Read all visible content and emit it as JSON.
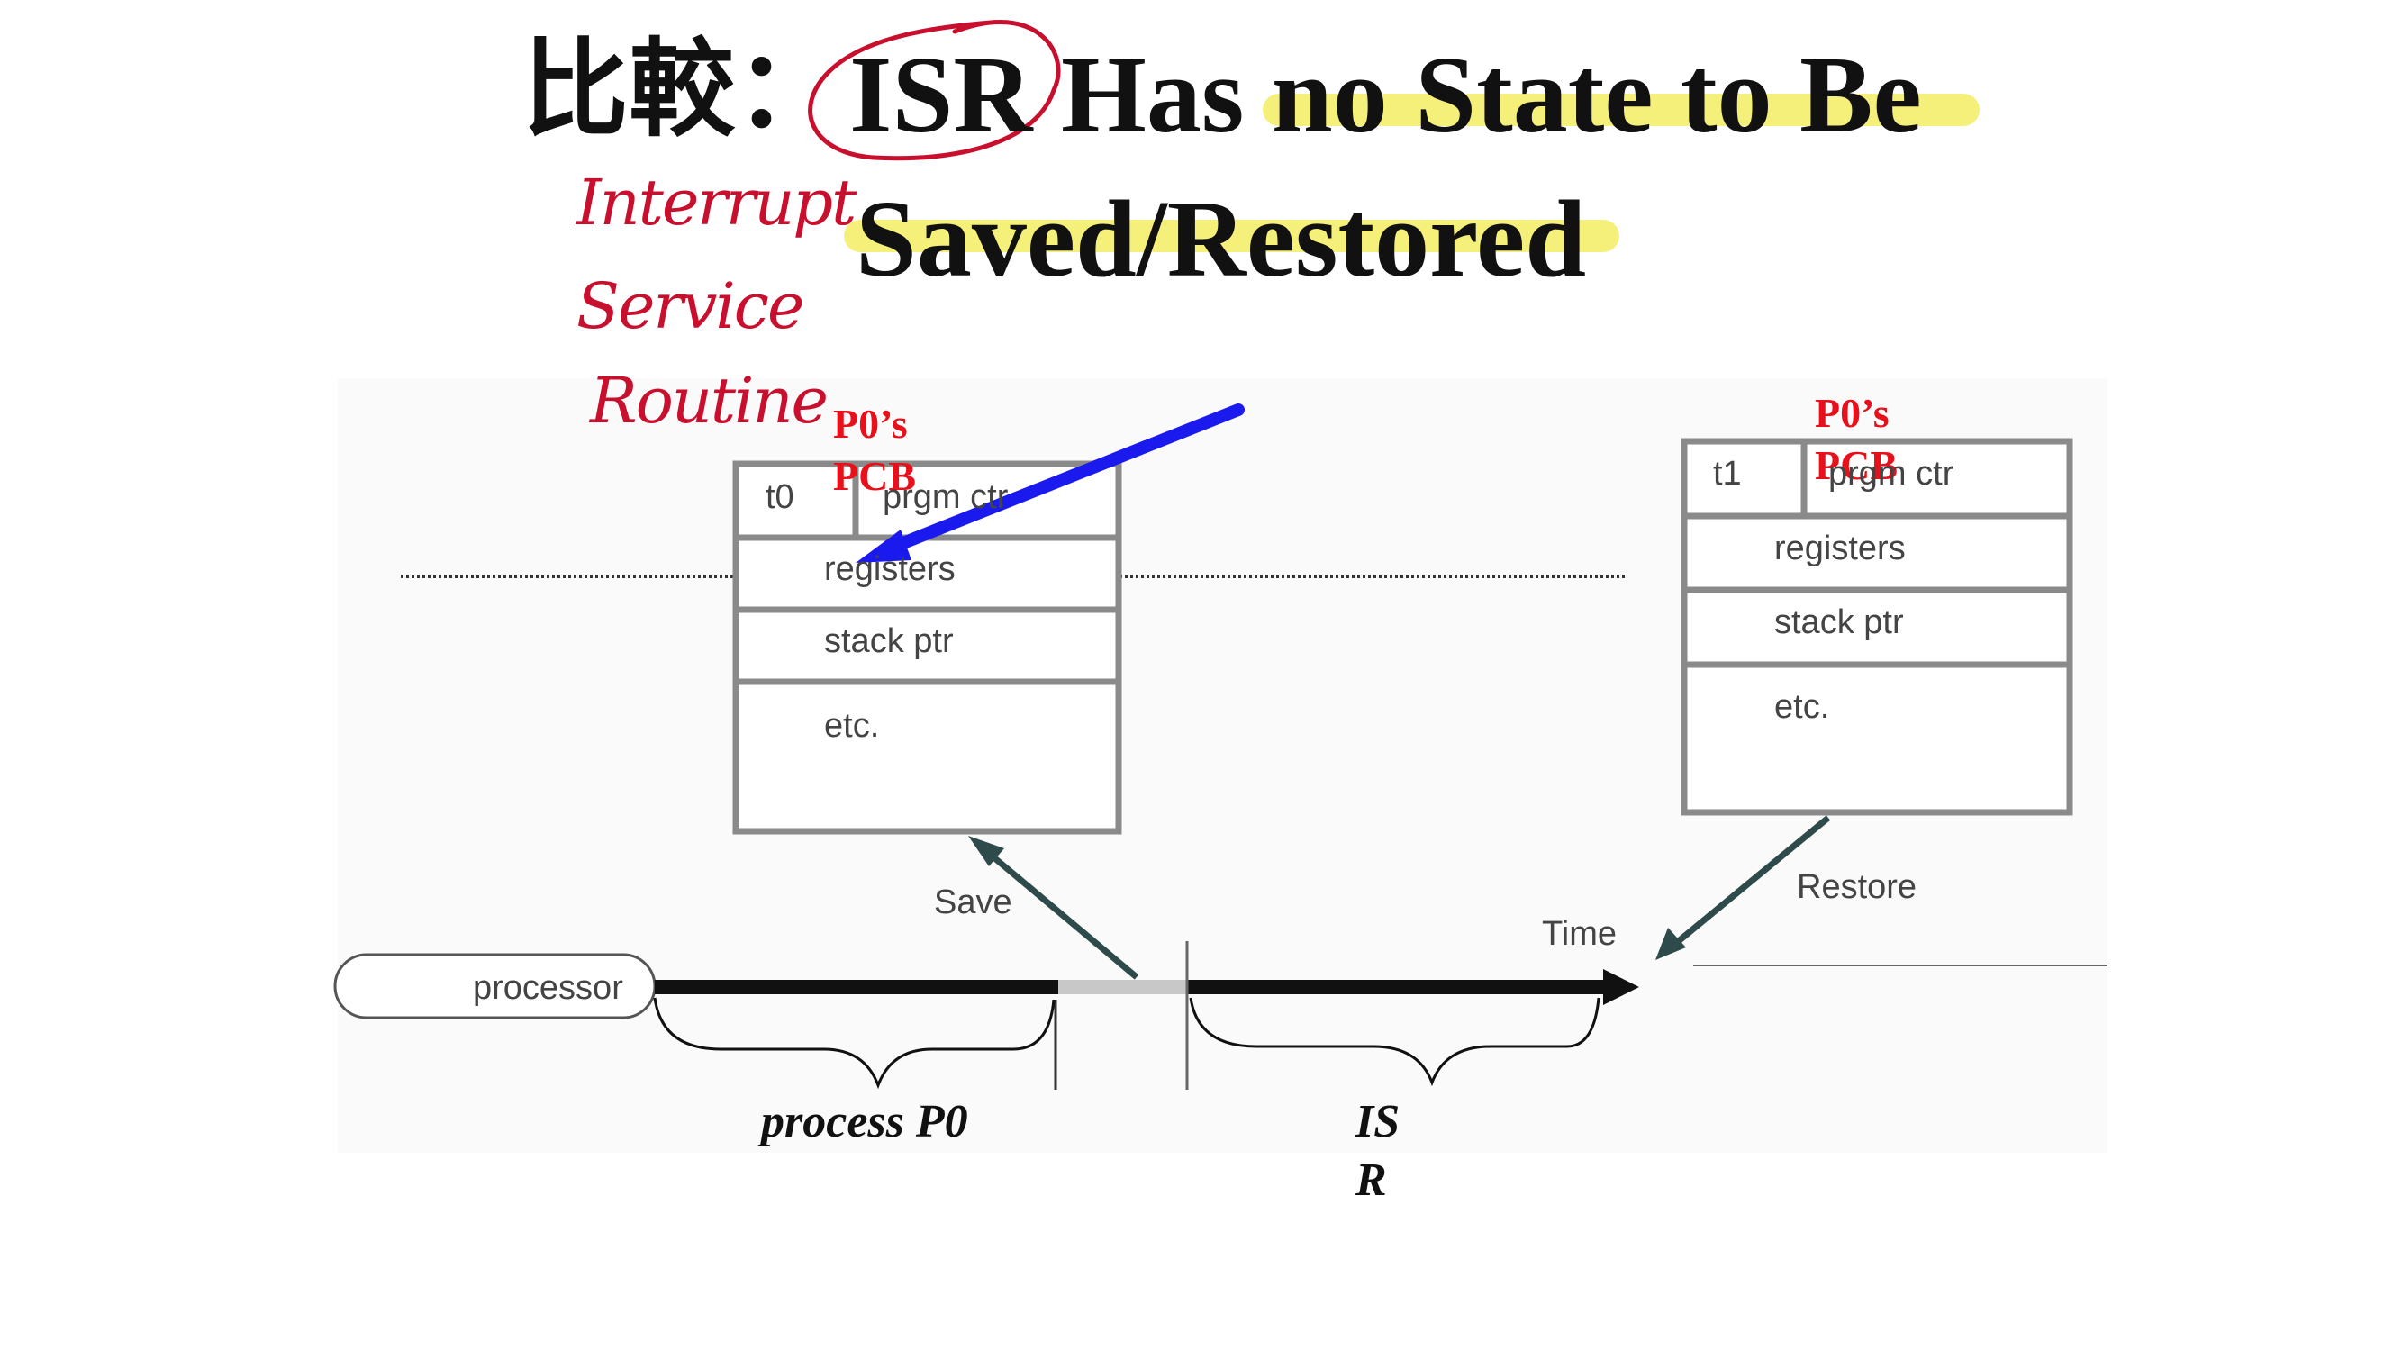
{
  "title": {
    "prefix": "比較：",
    "isr": "ISR",
    "line1_rest": "Has no State to Be",
    "line2": "Saved/Restored"
  },
  "annotation": {
    "line1": "Interrupt",
    "line2": "Service",
    "line3": "Routine"
  },
  "pcb_left": {
    "label_line1": "P0’s",
    "label_line2": "PCB",
    "time": "t0",
    "pc": "prgm ctr",
    "registers": "registers",
    "stack": "stack ptr",
    "etc": "etc."
  },
  "pcb_right": {
    "label_line1": "P0’s",
    "label_line2": "PCB",
    "time": "t1",
    "pc": "prgm ctr",
    "registers": "registers",
    "stack": "stack ptr",
    "etc": "etc."
  },
  "timeline": {
    "processor": "processor",
    "save": "Save",
    "restore": "Restore",
    "time": "Time",
    "process_label": "process P0",
    "isr_label_line1": "IS",
    "isr_label_line2": "R"
  },
  "colors": {
    "highlight": "#f5f07a",
    "annotation_red": "#c8102e",
    "pointer_blue": "#1a1aee",
    "label_red": "#e8101a",
    "box_stroke": "#8a8a8a"
  }
}
